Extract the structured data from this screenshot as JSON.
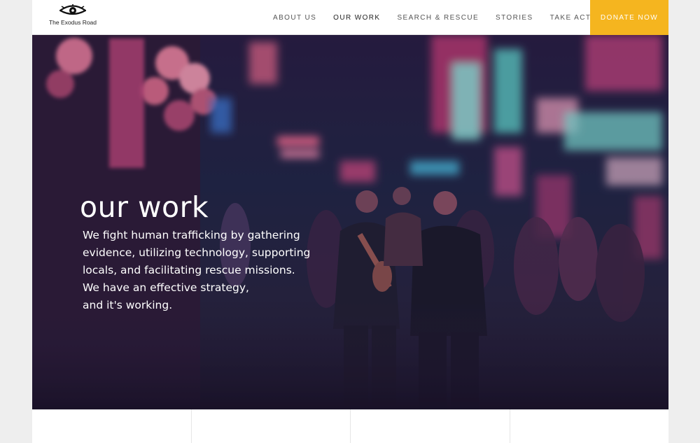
{
  "header": {
    "logo_text": "The Exodus Road",
    "nav": [
      {
        "label": "ABOUT US"
      },
      {
        "label": "OUR WORK"
      },
      {
        "label": "SEARCH & RESCUE"
      },
      {
        "label": "STORIES"
      },
      {
        "label": "TAKE ACTION"
      }
    ],
    "donate_label": "DONATE NOW"
  },
  "hero": {
    "title": "our work",
    "lines": [
      "We fight human trafficking by gathering",
      "evidence, utilizing technology, supporting",
      "locals, and facilitating rescue missions.",
      "We have an effective strategy,",
      "and it's working."
    ]
  },
  "stats": [
    {
      "value": ""
    },
    {
      "value": ""
    },
    {
      "value": ""
    },
    {
      "value": ""
    }
  ],
  "colors": {
    "accent": "#f5b51f",
    "neon_pink": "#e0367e",
    "neon_cyan": "#5de3d8"
  }
}
